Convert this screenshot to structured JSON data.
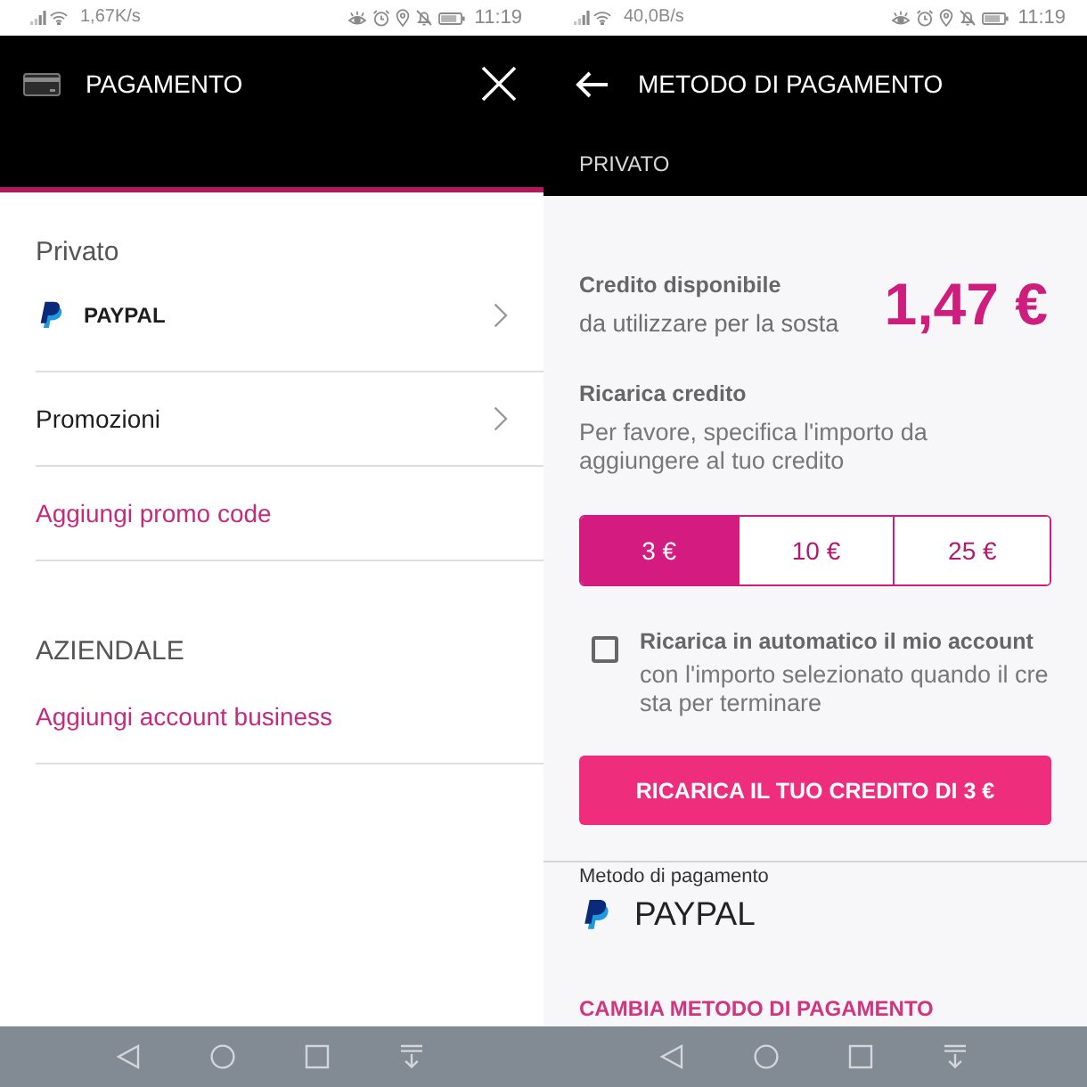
{
  "payment_screen": {
    "status_bar": {
      "speed": "1,67K/s",
      "time": "11:19"
    },
    "header": {
      "title": "PAGAMENTO"
    },
    "sections": [
      {
        "label": "Privato",
        "items": [
          {
            "kind": "method",
            "label": "PAYPAL"
          },
          {
            "kind": "nav",
            "label": "Promozioni"
          },
          {
            "kind": "link",
            "label": "Aggiungi promo code"
          }
        ]
      },
      {
        "label": "AZIENDALE",
        "items": [
          {
            "kind": "link",
            "label": "Aggiungi account business"
          }
        ]
      }
    ]
  },
  "method_screen": {
    "status_bar": {
      "speed": "40,0B/s",
      "time": "11:19"
    },
    "header": {
      "title": "METODO DI PAGAMENTO",
      "subtitle": "PRIVATO"
    },
    "credit": {
      "title": "Credito disponibile",
      "caption": "da utilizzare per la sosta",
      "amount": "1,47 €"
    },
    "recharge": {
      "title": "Ricarica credito",
      "hint": "Per favore, specifica l'importo da aggiungere al tuo credito",
      "amounts": [
        {
          "label": "3 €",
          "selected": true
        },
        {
          "label": "10 €",
          "selected": false
        },
        {
          "label": "25 €",
          "selected": false
        }
      ]
    },
    "auto_recharge": {
      "checked": false,
      "title": "Ricarica in automatico il mio account",
      "description_lines": [
        "con l'importo selezionato quando il cre",
        "sta per terminare"
      ]
    },
    "recharge_button": "RICARICA IL TUO CREDITO DI 3 €",
    "payment_method": {
      "label": "Metodo di pagamento",
      "name": "PAYPAL"
    },
    "change_method_link": "CAMBIA METODO DI PAGAMENTO"
  }
}
